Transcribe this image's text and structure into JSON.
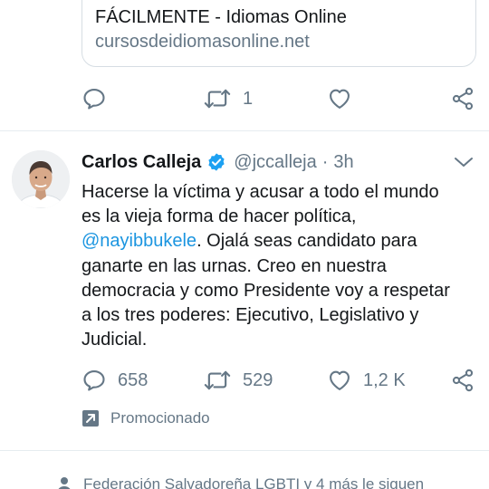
{
  "link_card": {
    "title": "FÁCILMENTE - Idiomas Online",
    "domain": "cursosdeidiomasonline.net"
  },
  "previous_actions": {
    "reply_count": "",
    "retweet_count": "1",
    "like_count": "",
    "icons": [
      "reply-icon",
      "retweet-icon",
      "like-icon",
      "share-icon"
    ]
  },
  "tweet": {
    "name": "Carlos Calleja",
    "handle": "@jccalleja",
    "separator": "·",
    "time": "3h",
    "text_lines": [
      "Hacerse la víctima y acusar a todo el mundo",
      "es la vieja forma de hacer política,",
      {
        "mention": "@nayibbukele",
        "rest": ". Ojalá seas candidato para"
      },
      "ganarte en las urnas. Creo en nuestra",
      "democracia y como Presidente voy a respetar",
      "a los tres poderes: Ejecutivo, Legislativo y",
      "Judicial."
    ],
    "reply_count": "658",
    "retweet_count": "529",
    "like_count": "1,2 K",
    "promoted_label": "Promocionado"
  },
  "footer": {
    "social_context": "Federación Salvadoreña LGBTI y 4 más le siguen"
  },
  "colors": {
    "text": "#14171a",
    "secondary": "#657786",
    "link": "#1b95e0",
    "verified": "#1da1f2",
    "border": "#e6ecf0"
  }
}
